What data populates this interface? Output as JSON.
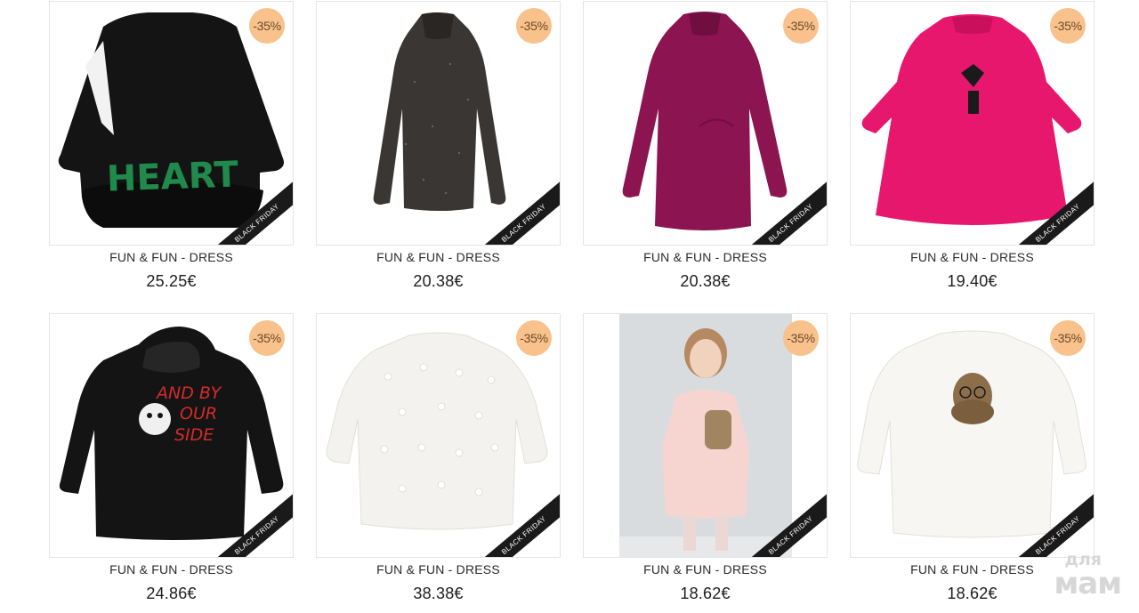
{
  "products": [
    {
      "brand_name": "FUN & FUN - DRESS",
      "price": "25.25€",
      "discount": "-35%",
      "ribbon": "BLACK FRIDAY"
    },
    {
      "brand_name": "FUN & FUN - DRESS",
      "price": "20.38€",
      "discount": "-35%",
      "ribbon": "BLACK FRIDAY"
    },
    {
      "brand_name": "FUN & FUN - DRESS",
      "price": "20.38€",
      "discount": "-35%",
      "ribbon": "BLACK FRIDAY"
    },
    {
      "brand_name": "FUN & FUN - DRESS",
      "price": "19.40€",
      "discount": "-35%",
      "ribbon": "BLACK FRIDAY"
    },
    {
      "brand_name": "FUN & FUN - DRESS",
      "price": "24.86€",
      "discount": "-35%",
      "ribbon": "BLACK FRIDAY"
    },
    {
      "brand_name": "FUN & FUN - DRESS",
      "price": "38.38€",
      "discount": "-35%",
      "ribbon": "BLACK FRIDAY"
    },
    {
      "brand_name": "FUN & FUN - DRESS",
      "price": "18.62€",
      "discount": "-35%",
      "ribbon": "BLACK FRIDAY"
    },
    {
      "brand_name": "FUN & FUN - DRESS",
      "price": "18.62€",
      "discount": "-35%",
      "ribbon": "BLACK FRIDAY"
    }
  ],
  "product_prints": {
    "heart_text": "HEART",
    "hoodie_text_1": "AND BY",
    "hoodie_text_2": "OUR",
    "hoodie_text_3": "SIDE"
  },
  "watermark": {
    "line1": "для",
    "line2": "мам"
  },
  "colors": {
    "badge": "#f9c18b",
    "ribbon": "#1a1a1a",
    "dress_black": "#141414",
    "dress_sparkle": "#3a3633",
    "dress_magenta": "#8c1450",
    "dress_pink": "#e8176e",
    "sweater_white": "#f4f2ee",
    "sweater_pink": "#f6d4d0"
  }
}
